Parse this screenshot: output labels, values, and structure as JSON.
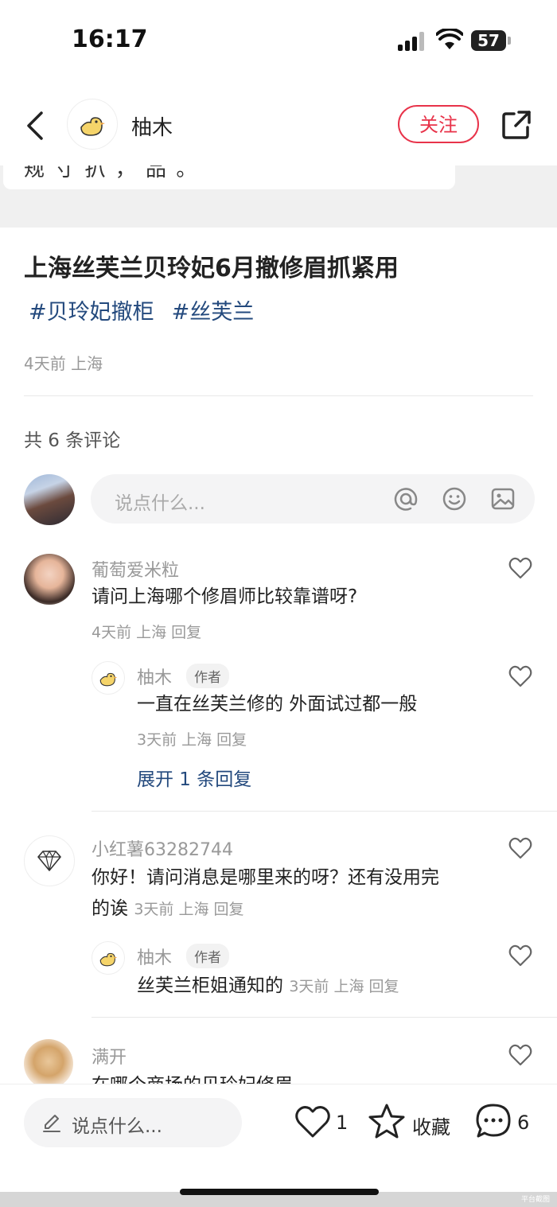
{
  "status_bar": {
    "time": "16:17",
    "battery": "57"
  },
  "header": {
    "author_name": "柚木",
    "follow_label": "关注"
  },
  "card_remnant": {
    "text": "规 寸 扒 ， 品 。"
  },
  "post": {
    "title": "上海丝芙兰贝玲妃6月撤修眉抓紧用",
    "tags": [
      "#贝玲妃撤柜",
      "#丝芙兰"
    ],
    "meta": "4天前 上海"
  },
  "comments_section": {
    "count_label": "共 6 条评论",
    "input_placeholder": "说点什么..."
  },
  "comments": [
    {
      "user": "葡萄爱米粒",
      "text": "请问上海哪个修眉师比较靠谱呀?",
      "meta": "4天前 上海 回复"
    },
    {
      "user": "柚木",
      "badge": "作者",
      "text": "一直在丝芙兰修的 外面试过都一般",
      "meta": "3天前 上海 回复",
      "expand": "展开 1 条回复"
    },
    {
      "user": "小红薯63282744",
      "text_line1": "你好！请问消息是哪里来的呀？还有没用完",
      "text_line2": "的诶",
      "meta": "3天前 上海 回复"
    },
    {
      "user": "柚木",
      "badge": "作者",
      "text": "丝芙兰柜姐通知的",
      "meta": "3天前 上海 回复"
    },
    {
      "user": "满开",
      "text": "在哪个商场的贝玲妃修眉"
    }
  ],
  "bottom_bar": {
    "input_placeholder": "说点什么...",
    "likes": "1",
    "collect_label": "收藏",
    "comments": "6"
  },
  "watermark": "平台截图"
}
